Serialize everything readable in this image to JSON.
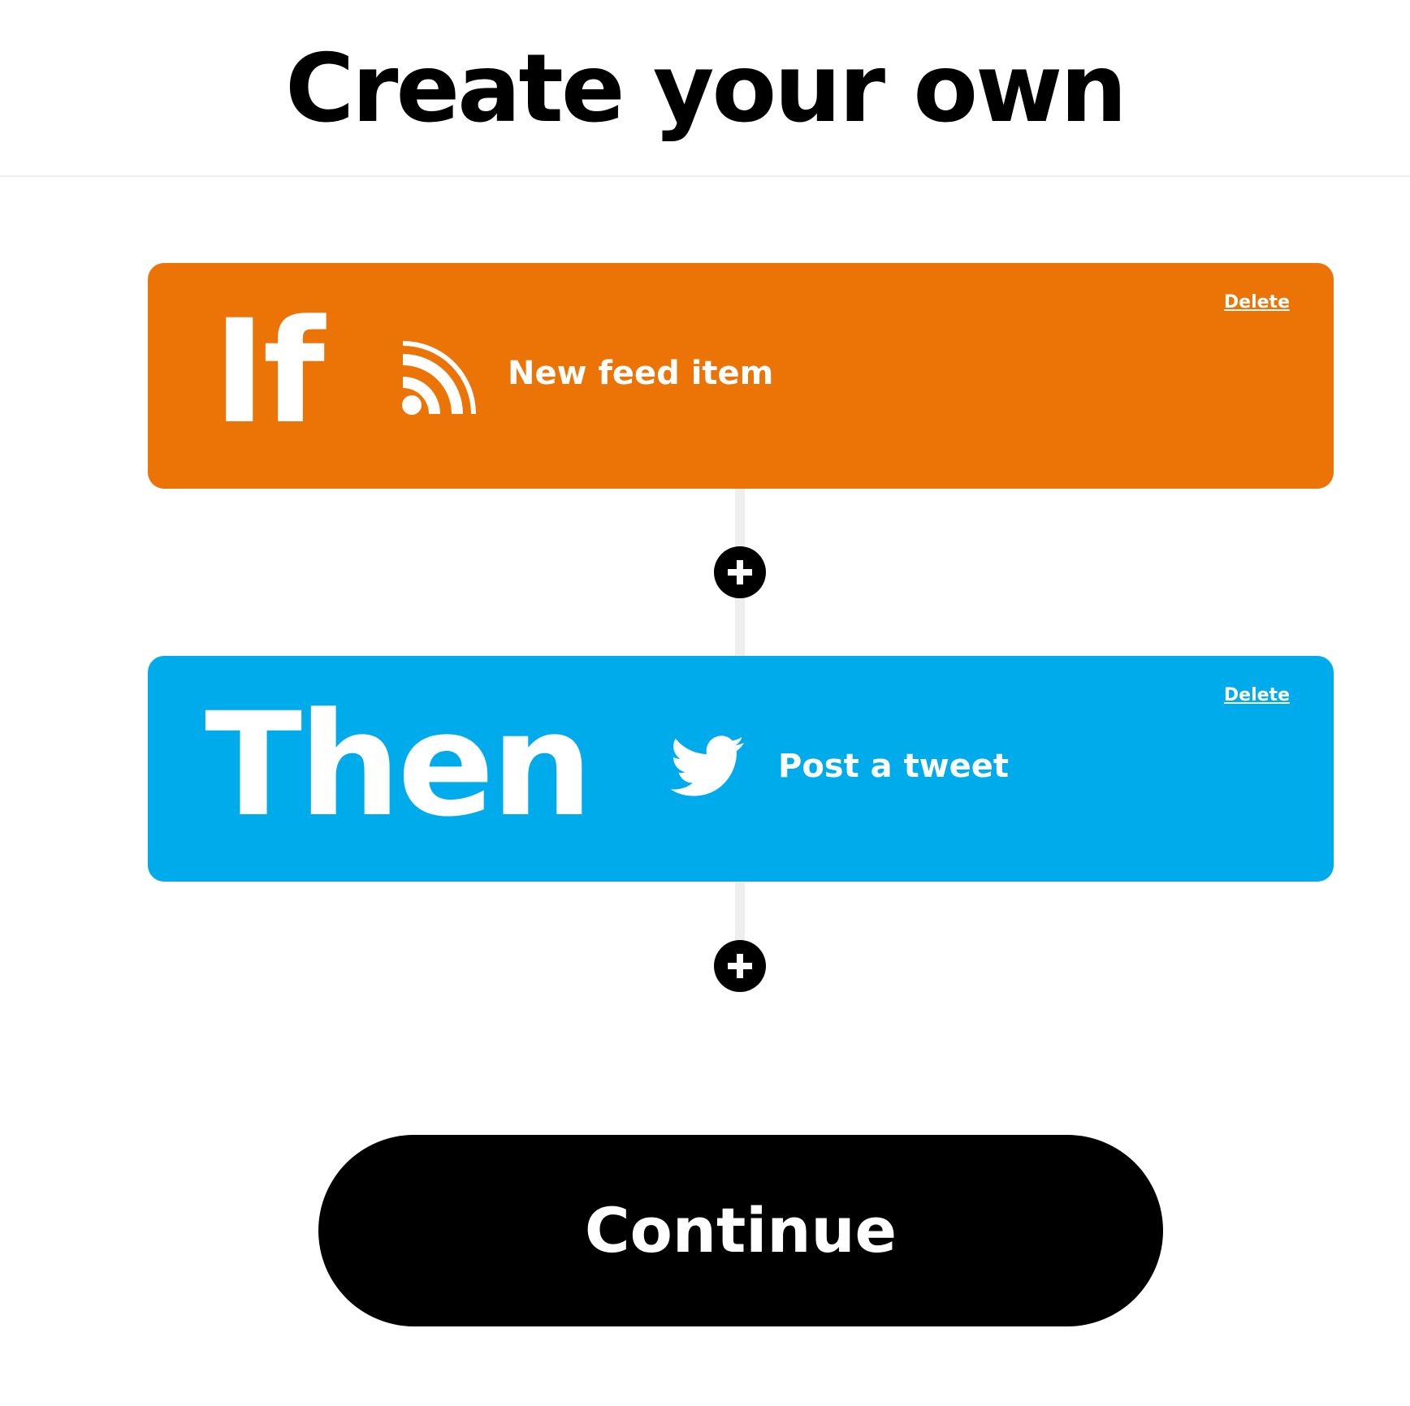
{
  "header": {
    "title": "Create your own"
  },
  "trigger": {
    "keyword": "If",
    "label": "New feed item",
    "delete_label": "Delete",
    "icon": "rss-feed-icon",
    "color": "#ec7306"
  },
  "action": {
    "keyword": "Then",
    "label": "Post a tweet",
    "delete_label": "Delete",
    "icon": "twitter-bird-icon",
    "color": "#00abec"
  },
  "add_step": {
    "icon": "plus-icon"
  },
  "footer": {
    "continue_label": "Continue"
  }
}
